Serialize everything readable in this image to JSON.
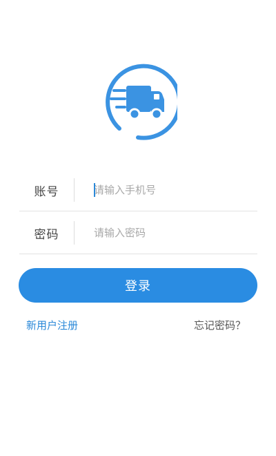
{
  "logo": {
    "icon": "truck-icon",
    "color": "#3b93e2"
  },
  "form": {
    "account": {
      "label": "账号",
      "placeholder": "请输入手机号",
      "value": ""
    },
    "password": {
      "label": "密码",
      "placeholder": "请输入密码",
      "value": ""
    }
  },
  "actions": {
    "login_label": "登录",
    "register_label": "新用户注册",
    "forgot_label": "忘记密码？"
  },
  "colors": {
    "accent": "#2a8ce2",
    "link": "#2a88d8"
  }
}
